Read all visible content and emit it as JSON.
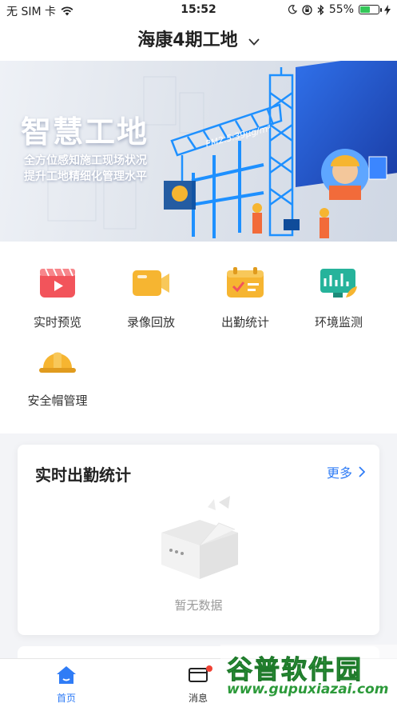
{
  "status_bar": {
    "carrier": "无 SIM 卡",
    "time": "15:52",
    "battery": "55%",
    "battery_level": 0.55
  },
  "header": {
    "title": "海康4期工地"
  },
  "banner": {
    "title": "智慧工地",
    "subtitle_1": "全方位感知施工现场状况",
    "subtitle_2": "提升工地精细化管理水平",
    "pm_label": "PM2.5:39μg/m³"
  },
  "features": [
    {
      "label": "实时预览",
      "icon": "video-player-icon",
      "color": "#f2545b"
    },
    {
      "label": "录像回放",
      "icon": "camera-recorder-icon",
      "color": "#f6b531"
    },
    {
      "label": "出勤统计",
      "icon": "attendance-card-icon",
      "color": "#f6b531"
    },
    {
      "label": "环境监测",
      "icon": "monitor-chart-icon",
      "color": "#26b39b"
    },
    {
      "label": "安全帽管理",
      "icon": "safety-helmet-icon",
      "color": "#f6b531"
    }
  ],
  "attendance_card": {
    "title": "实时出勤统计",
    "more_label": "更多",
    "empty_text": "暂无数据"
  },
  "tabbar": {
    "items": [
      {
        "label": "首页",
        "icon": "home-icon",
        "active": true
      },
      {
        "label": "消息",
        "icon": "message-icon",
        "badge": true
      }
    ]
  },
  "watermark": {
    "title": "谷普软件园",
    "url": "www.gupuxiazai.com"
  },
  "colors": {
    "accent": "#2f7cf6",
    "badge": "#f04134"
  }
}
